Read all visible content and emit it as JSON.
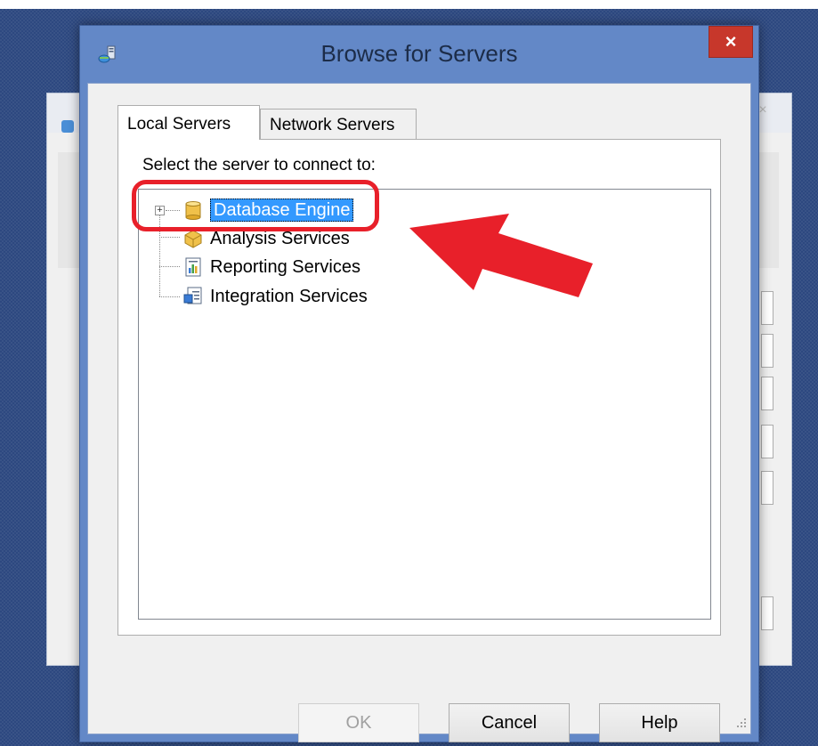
{
  "background_window": {
    "close_glyph": "×"
  },
  "dialog": {
    "title": "Browse for Servers",
    "close_glyph": "×",
    "title_icon": "server-network-icon"
  },
  "tabs": [
    {
      "label": "Local Servers",
      "selected": true
    },
    {
      "label": "Network Servers",
      "selected": false
    }
  ],
  "prompt": "Select the server to connect to:",
  "tree": {
    "items": [
      {
        "label": "Database Engine",
        "icon": "database-cylinder-icon",
        "selected": true,
        "expandable": true,
        "expand_glyph": "+"
      },
      {
        "label": "Analysis Services",
        "icon": "analysis-cube-icon"
      },
      {
        "label": "Reporting Services",
        "icon": "report-chart-icon"
      },
      {
        "label": "Integration Services",
        "icon": "integration-package-icon"
      }
    ]
  },
  "buttons": {
    "ok": "OK",
    "cancel": "Cancel",
    "help": "Help"
  },
  "annotation": {
    "ring_color": "#e8202a",
    "arrow_color": "#e8202a"
  },
  "colors": {
    "title_bar": "#6388c7",
    "close_button": "#c7372b",
    "selection": "#3399ff"
  }
}
